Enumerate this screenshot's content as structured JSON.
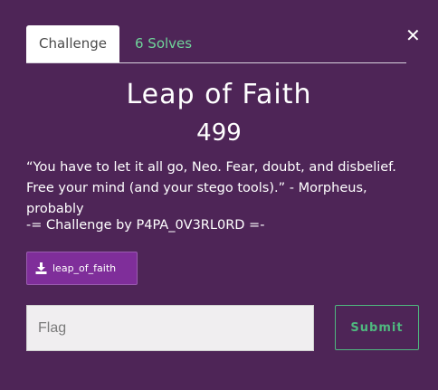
{
  "modal": {
    "close_icon": "close-icon",
    "tabs": [
      {
        "label": "Challenge",
        "active": true
      },
      {
        "label": "6 Solves",
        "active": false
      }
    ],
    "title": "Leap of Faith",
    "points": "499",
    "description": "“You have to let it all go, Neo. Fear, doubt, and disbelief. Free your mind (and your stego tools).” - Morpheus, probably",
    "author": "-= Challenge by P4PA_0V3RL0RD =-",
    "file": {
      "icon": "download-icon",
      "name": "leap_of_faith"
    },
    "flag_input": {
      "value": "",
      "placeholder": "Flag"
    },
    "submit_label": "Submit"
  },
  "colors": {
    "background": "#4e2557",
    "tab_active_bg": "#ffffff",
    "tab_inactive_text": "#6fd39a",
    "file_button_bg": "#7f2e9a",
    "submit_border": "#4fb87f",
    "input_bg": "#f0eef0"
  }
}
